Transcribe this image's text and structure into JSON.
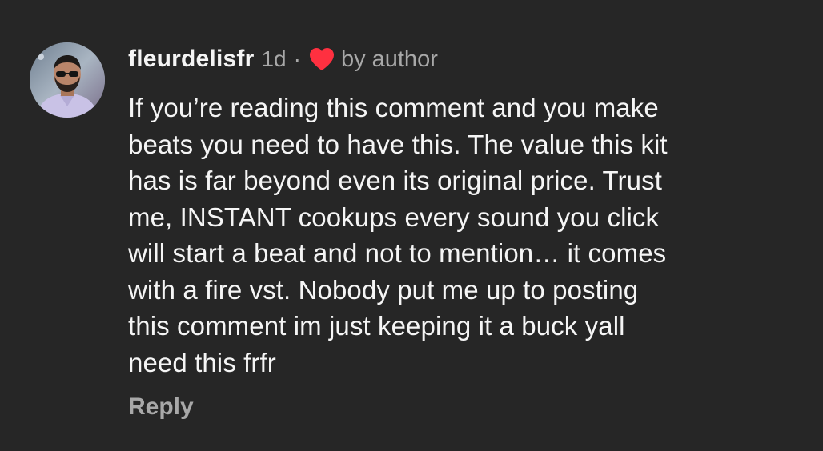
{
  "comment": {
    "username": "fleurdelisfr",
    "age": "1d",
    "separator": "·",
    "liked_by": "by author",
    "heart_icon": "heart-icon",
    "heart_color": "#ff3040",
    "text_lines": [
      "If you’re reading this comment and you make",
      "beats you need to have this. The value this kit",
      "has is far beyond even its original price. Trust",
      "me, INSTANT cookups every sound you click",
      "will start a beat and not to mention… it comes",
      "with a fire vst. Nobody put me up to posting",
      "this comment im just keeping it a buck yall",
      "need this frfr"
    ],
    "reply_label": "Reply"
  },
  "colors": {
    "background": "#262626",
    "primary_text": "#f5f5f5",
    "secondary_text": "#a8a8a8"
  }
}
